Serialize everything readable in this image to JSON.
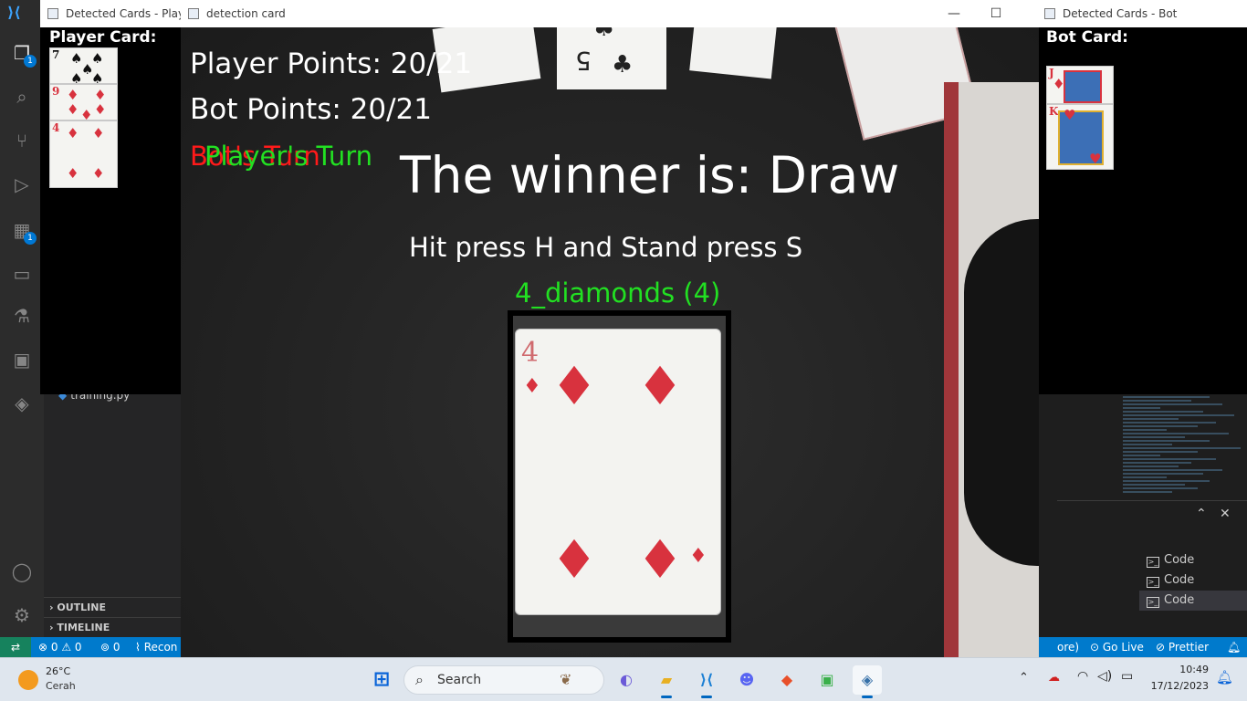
{
  "vscode": {
    "explorer_badge": "1",
    "extensions_badge": "1",
    "file_name": "training.py",
    "sections": [
      "OUTLINE",
      "TIMELINE"
    ],
    "terminals": [
      "Code",
      "Code",
      "Code"
    ],
    "status": {
      "errors": "0",
      "warnings": "0",
      "ports": "0",
      "remote": "Recon",
      "right_partial": "ore)",
      "go_live": "Go Live",
      "prettier": "Prettier"
    }
  },
  "player_window": {
    "title": "Detected Cards - Player",
    "label": "Player Card:",
    "cards": [
      {
        "rank": "7",
        "suit": "spades"
      },
      {
        "rank": "9",
        "suit": "diamonds"
      },
      {
        "rank": "4",
        "suit": "diamonds"
      }
    ]
  },
  "bot_window": {
    "title": "Detected Cards - Bot",
    "label": "Bot Card:",
    "cards": [
      {
        "rank": "J",
        "suit": "diamonds"
      },
      {
        "rank": "K",
        "suit": "hearts"
      }
    ]
  },
  "detection_window": {
    "title": "detection card",
    "player_points": "Player Points: 20/21",
    "bot_points": "Bot Points: 20/21",
    "turn_red": "Bot's Turn",
    "turn_green": "Player's Turn",
    "winner": "The winner is: Draw",
    "instructions": "Hit press H and Stand press S",
    "detected_label": "4_diamonds (4)",
    "detected_card_rank": "4",
    "colors": {
      "text": "#ffffff",
      "green": "#22e022",
      "red": "#ff1a1a"
    }
  },
  "taskbar": {
    "weather_temp": "26°C",
    "weather_desc": "Cerah",
    "search_placeholder": "Search",
    "time": "10:49",
    "date": "17/12/2023"
  }
}
